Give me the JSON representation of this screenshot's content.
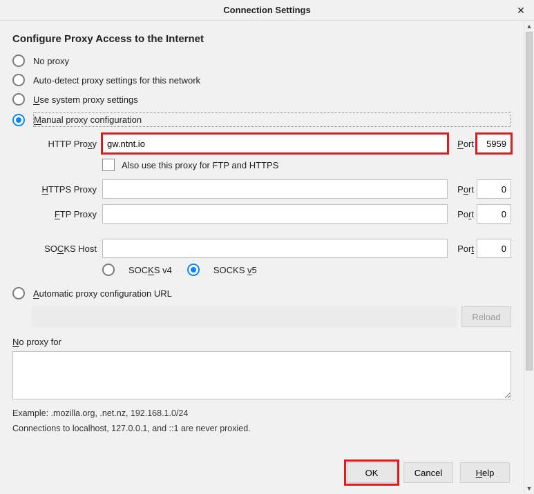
{
  "window": {
    "title": "Connection Settings"
  },
  "heading": "Configure Proxy Access to the Internet",
  "radios": {
    "no_proxy": "No proxy",
    "auto_detect": "Auto-detect proxy settings for this network",
    "use_system_pre": "U",
    "use_system_rest": "se system proxy settings",
    "manual_pre": "M",
    "manual_rest": "anual proxy configuration",
    "auto_url_pre": "A",
    "auto_url_rest": "utomatic proxy configuration URL"
  },
  "proxy": {
    "http_label_pre": "HTTP Pro",
    "http_label_u": "x",
    "http_label_post": "y",
    "http_host": "gw.ntnt.io",
    "http_port_label_u": "P",
    "http_port_label_rest": "ort",
    "http_port": "5959",
    "also_use": "Also use this proxy for FTP and HTTPS",
    "https_label_u": "H",
    "https_label_rest": "TTPS Proxy",
    "https_host": "",
    "https_port_label_pre": "P",
    "https_port_label_u": "o",
    "https_port_label_post": "rt",
    "https_port": "0",
    "ftp_label_u": "F",
    "ftp_label_rest": "TP Proxy",
    "ftp_host": "",
    "ftp_port_label_pre": "Po",
    "ftp_port_label_u": "r",
    "ftp_port_label_post": "t",
    "ftp_port": "0",
    "socks_label": "SO",
    "socks_label_u": "C",
    "socks_label_rest": "KS Host",
    "socks_host": "",
    "socks_port_label_pre": "Por",
    "socks_port_label_u": "t",
    "socks_port": "0",
    "socks_v4_pre": "SOC",
    "socks_v4_u": "K",
    "socks_v4_rest": "S v4",
    "socks_v5_pre": "SOCKS ",
    "socks_v5_u": "v",
    "socks_v5_rest": "5"
  },
  "auto_url": {
    "value": "",
    "reload": "Reload"
  },
  "no_proxy_for": {
    "label_u": "N",
    "label_rest": "o proxy for",
    "value": ""
  },
  "example": "Example: .mozilla.org, .net.nz, 192.168.1.0/24",
  "note": "Connections to localhost, 127.0.0.1, and ::1 are never proxied.",
  "buttons": {
    "ok": "OK",
    "cancel": "Cancel",
    "help_u": "H",
    "help_rest": "elp"
  }
}
